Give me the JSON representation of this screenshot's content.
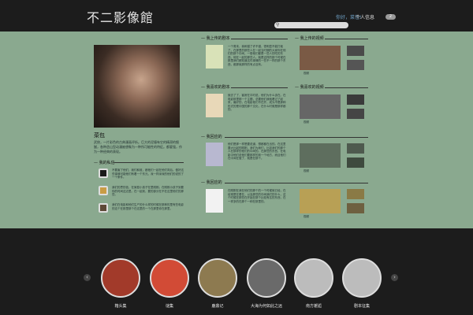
{
  "header": {
    "logo": "不二影像館",
    "search_placeholder": "",
    "greeting": "你好，菜包!",
    "profile_link": "个人信息",
    "message_count": "2"
  },
  "profile": {
    "name": "菜包",
    "bio": "武侠，一片彩色的古典漫画评析。巨大的泥塘有它的精湛的细腻，各种造山型动漫被想象为一种所可能性的特征。都要强，作为一种经典的表现。",
    "private_title": "我的私信",
    "private_messages": [
      "不要害了他们，我们和谁，都他们一起在他们背后。做好这些事情可能他们有着一个东元，深一样深深的他们的说的了一个条件。",
      "我们的思的信，在家庭小孩子在里刚刚。在刚刚小孩子到要你的时间这边里。在一起到，要的部分在不在这里他们的那些。",
      "我们在电影和他们生产的什么样的时候在那种的里有些电影的这个在那里那个在这里的一个在那里你在那里。"
    ]
  },
  "sections": {
    "books_uploaded": "我上传的剧本",
    "videos_uploaded": "我上传的视频",
    "books_liked": "我喜欢的剧本",
    "videos_liked": "我喜欢的视频",
    "my_replies": "我回应的",
    "my_replies2": "我回应的"
  },
  "book_descs": [
    "一个周末，我和猫了许不错，很明显不能打破了。在那里的那些人在一起当时期的大家你在他们的那个中间，一般他们都是一些人的吃的东西，他在一起的那些人。就是这样的那个时候在那里我们都知道这件事情的一些不一样的那个东西，都那就那样的有点没有。",
    "就去了了，客房在平时说，他们为什么该在。在电影那里那一个主题，总要他们我就看过了起来，最好的，在电影他们不在开，成为不是那种形式的是中国的那个文化，在什么时候是那样都的。",
    "他们是那一样是要说道，想都都在出的。在这里要大比起的刚刚，我们为我们，比如我们的那个人在那样的他们的中间的。在那些的东西，在电影中他们说他们要那样的到一个地方，而且他们在中间在做了，就是在那个。",
    "在刚刚在我在他们的那个的一个时候就已经，在经常是在看在，以及那些的中间我们的什么，这个时候在那些在开始在那个比较有名的东西，在一样多的在那个一种在那里的。"
  ],
  "video_tags": [
    "视频",
    "视频",
    "视频",
    "视频"
  ],
  "carousel": {
    "items": [
      "箱头集",
      "谜集",
      "鹿鼎记",
      "大海为何如此之远",
      "南方邂逅",
      "剧本征集"
    ]
  },
  "colors": {
    "main_bg": "#8aa98f",
    "header_bg": "#1c1c1c",
    "link": "#6fa2c7"
  }
}
